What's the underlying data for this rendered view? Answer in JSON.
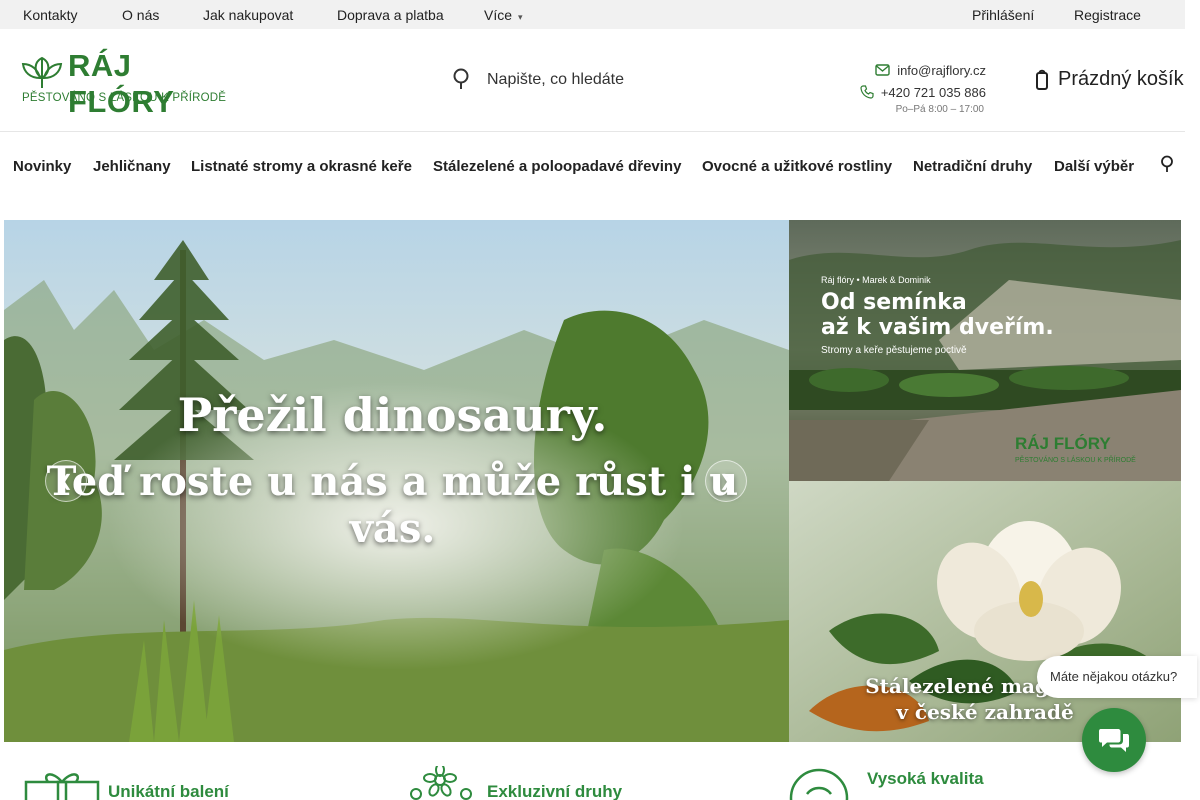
{
  "topbar": {
    "links": [
      "Kontakty",
      "O nás",
      "Jak nakupovat",
      "Doprava a platba",
      "Více"
    ],
    "login": "Přihlášení",
    "register": "Registrace"
  },
  "header": {
    "logo_title": "RÁJ FLÓRY",
    "logo_subtitle": "PĚSTOVÁNO S LÁSKOU K PŘÍRODĚ",
    "search_placeholder": "Napište, co hledáte",
    "email": "info@rajflory.cz",
    "phone": "+420 721 035 886",
    "hours": "Po–Pá 8:00 – 17:00",
    "cart_label": "Prázdný košík"
  },
  "nav": {
    "items": [
      "Novinky",
      "Jehličnany",
      "Listnaté stromy a okrasné keře",
      "Stálezelené a poloopadavé dřeviny",
      "Ovocné a užitkové rostliny",
      "Netradiční druhy",
      "Další výběr"
    ]
  },
  "hero": {
    "line1": "Přežil dinosaury.",
    "line2": "Teď roste u nás a může růst i u vás."
  },
  "banner1": {
    "small": "Ráj flóry • Marek & Dominik",
    "title_line1": "Od semínka",
    "title_line2": "až k vašim dveřím.",
    "subtitle": "Stromy a keře pěstujeme poctivě",
    "logo_title": "RÁJ FLÓRY",
    "logo_sub": "PĚSTOVÁNO S LÁSKOU K PŘÍRODĚ"
  },
  "banner2": {
    "line1": "Stálezelené magnolie",
    "line2": "v české zahradě"
  },
  "chat": {
    "question": "Máte nějakou otázku?"
  },
  "features": [
    "Unikátní balení",
    "Exkluzivní druhy",
    "Vysoká kvalita"
  ],
  "colors": {
    "brand_green": "#2e7d32",
    "accent_green": "#2e8b3e",
    "topbar_bg": "#f1f1f1"
  }
}
